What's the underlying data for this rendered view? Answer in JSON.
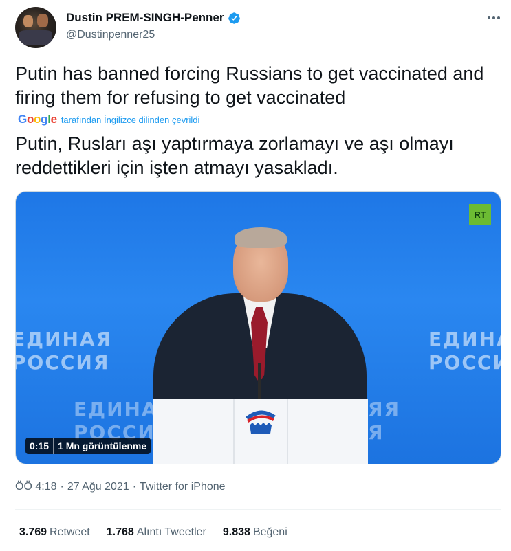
{
  "author": {
    "display_name": "Dustin PREM-SINGH-Penner",
    "handle": "@Dustinpenner25",
    "verified": true
  },
  "tweet": {
    "text": "Putin has banned forcing Russians to get vaccinated and firing them for refusing to get vaccinated",
    "translation": {
      "provider": "Google",
      "note": "tarafından İngilizce dilinden çevrildi",
      "text": "Putin, Rusları aşı yaptırmaya zorlamayı ve aşı olmayı reddettikleri için işten atmayı yasakladı."
    }
  },
  "media": {
    "channel_logo": "RT",
    "bg_text_left": "ЕДИНАЯ\nРОССИЯ",
    "bg_text_right": "ЕДИНА\nРОССИ",
    "bg_text_center": "ЕДИНА\nРОССИ",
    "bg_text_center_right": "ЯЯ\nЯ",
    "duration": "0:15",
    "views": "1 Mn görüntülenme"
  },
  "meta": {
    "time": "ÖÖ 4:18",
    "date": "27 Ağu 2021",
    "source": "Twitter for iPhone",
    "separator": "·"
  },
  "stats": {
    "retweets_count": "3.769",
    "retweets_label": "Retweet",
    "quotes_count": "1.768",
    "quotes_label": "Alıntı Tweetler",
    "likes_count": "9.838",
    "likes_label": "Beğeni"
  },
  "colors": {
    "accent": "#1d9bf0",
    "text": "#0f1419",
    "secondary": "#536471",
    "media_bg": "#1e77e6",
    "rt_green": "#6cbb33"
  }
}
